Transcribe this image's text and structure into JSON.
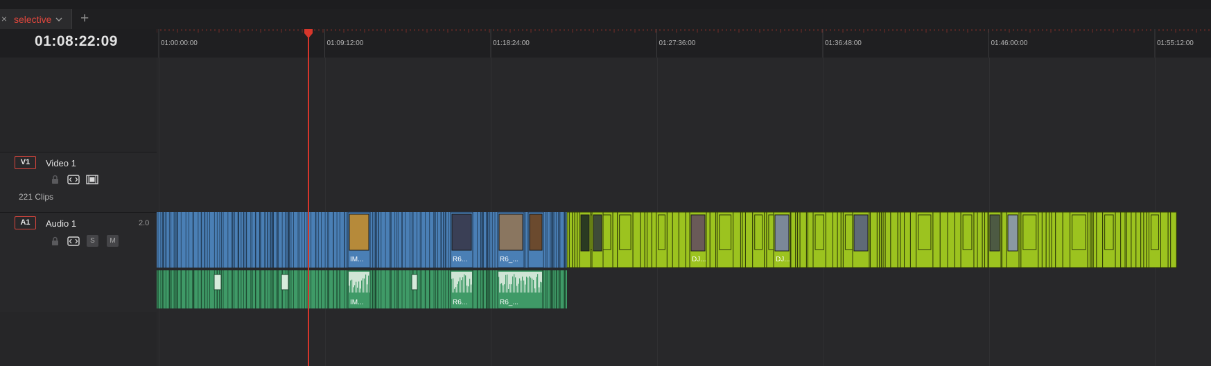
{
  "window": {
    "tab": {
      "label": "selective",
      "close_icon": "close-icon",
      "dropdown_icon": "chevron-down-icon"
    },
    "add_tab_icon": "plus-icon"
  },
  "header": {
    "timecode": "01:08:22:09"
  },
  "ruler": {
    "labels": [
      "01:00:00:00",
      "01:09:12:00",
      "01:18:24:00",
      "01:27:36:00",
      "01:36:48:00",
      "01:46:00:00",
      "01:55:12:00"
    ]
  },
  "playhead": {
    "timecode": "01:08:22:09",
    "color": "#d6362b"
  },
  "tracks": {
    "video": {
      "id": "V1",
      "name": "Video 1",
      "clip_count": "221 Clips",
      "icons": [
        "lock-icon",
        "auto-select-icon",
        "film-icon"
      ]
    },
    "audio": {
      "id": "A1",
      "name": "Audio 1",
      "channels": "2.0",
      "icons": [
        "lock-icon",
        "auto-select-icon"
      ],
      "solo_label": "S",
      "mute_label": "M"
    }
  },
  "clips": {
    "video_labels": [
      {
        "text": "IM...",
        "color": "blue"
      },
      {
        "text": "R6...",
        "color": "blue"
      },
      {
        "text": "R6_...",
        "color": "blue"
      },
      {
        "text": "DJ...",
        "color": "lime"
      },
      {
        "text": "DJ...",
        "color": "lime"
      }
    ],
    "audio_labels": [
      {
        "text": "IM..."
      },
      {
        "text": "R6..."
      },
      {
        "text": "R6_..."
      }
    ]
  },
  "colors": {
    "video_blue": "#4a7fb5",
    "video_lime": "#9cc31f",
    "audio_green": "#3f9a67",
    "accent_red": "#e0473d"
  }
}
